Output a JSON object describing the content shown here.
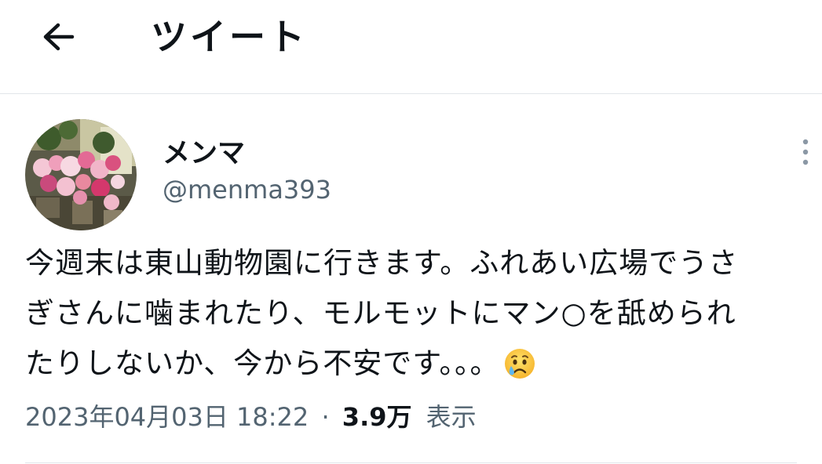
{
  "header": {
    "title": "ツイート",
    "back_icon": "arrow-left-icon"
  },
  "tweet": {
    "author": {
      "display_name": "メンマ",
      "handle": "@menma393"
    },
    "text_lines": [
      "今週末は東山動物園に行きます。ふれあい広場でうさ",
      "ぎさんに噛まれたり、モルモットにマン○を舐められ",
      "たりしないか、今から不安です。。。"
    ],
    "emoji": "crying-face",
    "timestamp": "2023年04月03日 18:22",
    "separator": "·",
    "views_count": "3.9万",
    "views_label": "表示",
    "more_icon": "more-vertical-icon"
  },
  "colors": {
    "text": "#0f1419",
    "secondary": "#536471",
    "border": "#e1e6ea"
  }
}
